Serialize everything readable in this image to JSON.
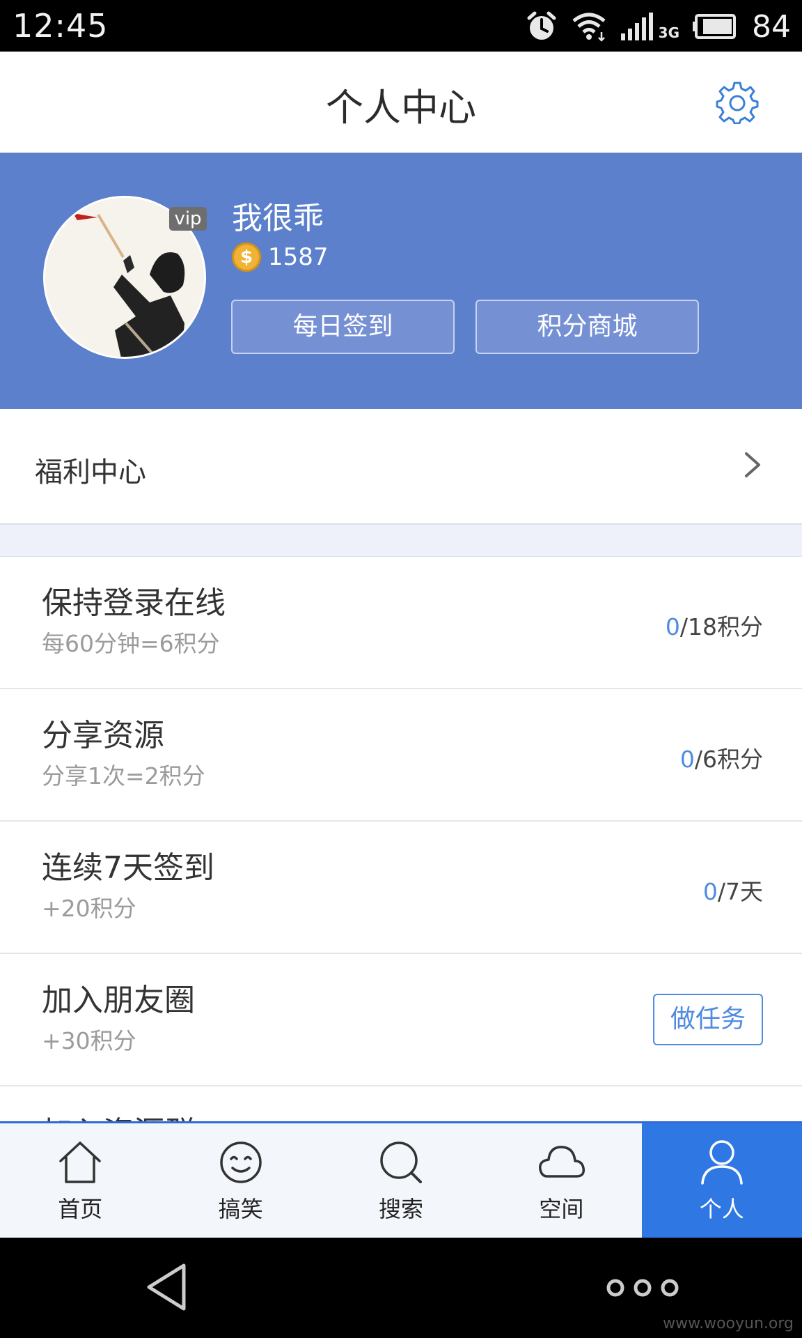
{
  "status_bar": {
    "time": "12:45",
    "network": "3G",
    "battery": "84",
    "icons": [
      "alarm-icon",
      "wifi-icon",
      "signal-icon",
      "battery-icon"
    ]
  },
  "header": {
    "title": "个人中心",
    "settings_icon": "gear-icon"
  },
  "profile": {
    "vip_label": "vip",
    "username": "我很乖",
    "coin_icon_glyph": "$",
    "coins": "1587",
    "checkin_label": "每日签到",
    "shop_label": "积分商城",
    "banner_color": "#5d80cc"
  },
  "welfare": {
    "label": "福利中心"
  },
  "tasks": [
    {
      "title": "保持登录在线",
      "subtitle": "每60分钟=6积分",
      "current": "0",
      "total": "/18积分"
    },
    {
      "title": "分享资源",
      "subtitle": "分享1次=2积分",
      "current": "0",
      "total": "/6积分"
    },
    {
      "title": "连续7天签到",
      "subtitle": "+20积分",
      "current": "0",
      "total": "/7天"
    },
    {
      "title": "加入朋友圈",
      "subtitle": "+30积分",
      "action": "做任务"
    },
    {
      "title": "加入资源群"
    }
  ],
  "bottom_nav": [
    {
      "label": "首页",
      "icon": "home-icon"
    },
    {
      "label": "搞笑",
      "icon": "smiley-icon"
    },
    {
      "label": "搜索",
      "icon": "search-icon"
    },
    {
      "label": "空间",
      "icon": "cloud-icon"
    },
    {
      "label": "个人",
      "icon": "user-icon",
      "active": true
    }
  ],
  "accent_color": "#2f78e3",
  "watermark": "www.wooyun.org"
}
